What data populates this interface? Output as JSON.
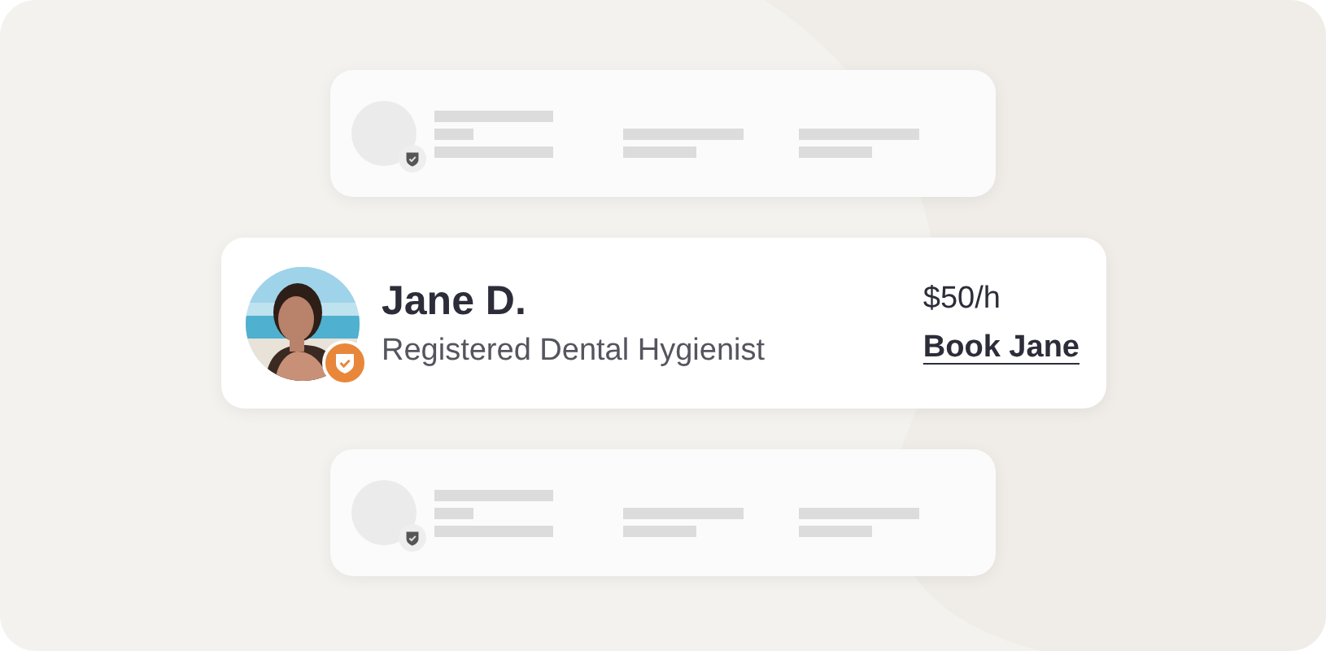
{
  "cards": [
    {
      "kind": "skeleton",
      "verified": true
    },
    {
      "kind": "profile",
      "name": "Jane D.",
      "title": "Registered Dental Hygienist",
      "rate": "$50/h",
      "action": "Book Jane",
      "verified": true
    },
    {
      "kind": "skeleton",
      "verified": true
    }
  ]
}
